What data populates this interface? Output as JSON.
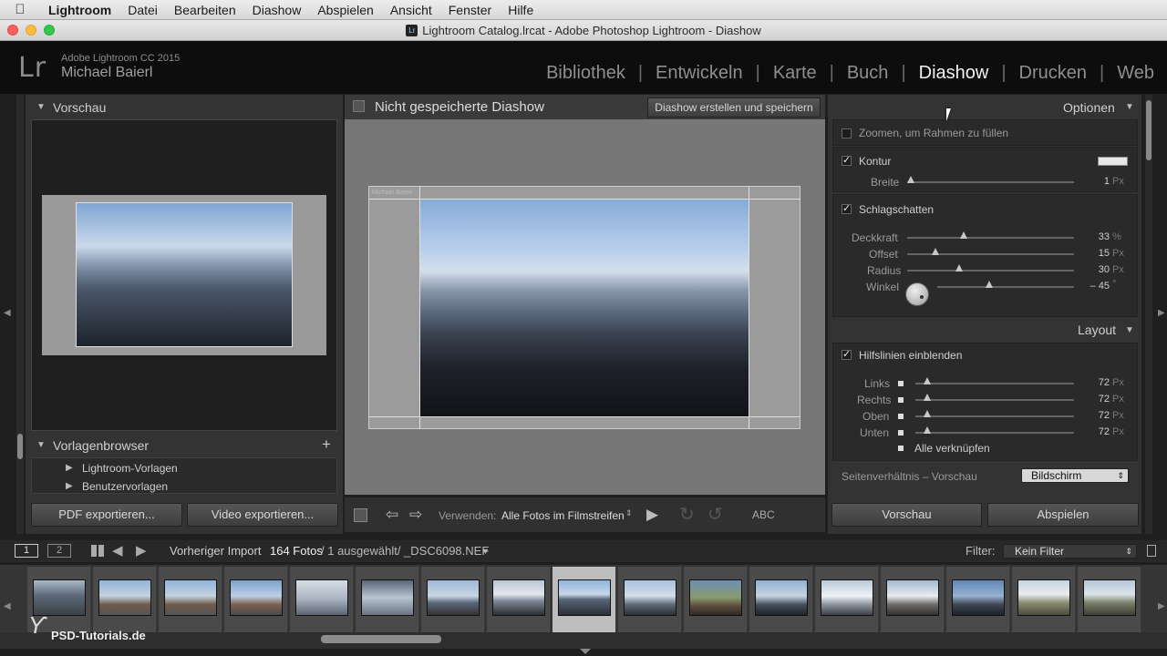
{
  "menubar": {
    "app": "Lightroom",
    "items": [
      "Datei",
      "Bearbeiten",
      "Diashow",
      "Abspielen",
      "Ansicht",
      "Fenster",
      "Hilfe"
    ]
  },
  "window": {
    "title": "Lightroom Catalog.lrcat - Adobe Photoshop Lightroom - Diashow"
  },
  "identity": {
    "logo": "Lr",
    "product": "Adobe Lightroom CC 2015",
    "user": "Michael Baierl"
  },
  "modules": [
    "Bibliothek",
    "Entwickeln",
    "Karte",
    "Buch",
    "Diashow",
    "Drucken",
    "Web"
  ],
  "left": {
    "preview_header": "Vorschau",
    "template_header": "Vorlagenbrowser",
    "templates": [
      "Lightroom-Vorlagen",
      "Benutzervorlagen"
    ],
    "pdf_button": "PDF exportieren...",
    "video_button": "Video exportieren..."
  },
  "center": {
    "title": "Nicht gespeicherte Diashow",
    "create_button": "Diashow erstellen und speichern",
    "identity_plate_text": "Michael Baierl",
    "use_label": "Verwenden:",
    "use_value": "Alle Fotos im Filmstreifen",
    "abc": "ABC"
  },
  "options": {
    "header": "Optionen",
    "zoom_label": "Zoomen, um Rahmen zu füllen",
    "kontur_label": "Kontur",
    "breite_label": "Breite",
    "breite_value": "1",
    "breite_unit": "Px",
    "shadow_label": "Schlagschatten",
    "deckkraft_label": "Deckkraft",
    "deckkraft_value": "33",
    "deckkraft_unit": "%",
    "offset_label": "Offset",
    "offset_value": "15",
    "offset_unit": "Px",
    "radius_label": "Radius",
    "radius_value": "30",
    "radius_unit": "Px",
    "winkel_label": "Winkel",
    "winkel_value": "– 45",
    "winkel_unit": "°"
  },
  "layout": {
    "header": "Layout",
    "guides_label": "Hilfslinien einblenden",
    "links_label": "Links",
    "links_value": "72",
    "rechts_label": "Rechts",
    "rechts_value": "72",
    "oben_label": "Oben",
    "oben_value": "72",
    "unten_label": "Unten",
    "unten_value": "72",
    "unit": "Px",
    "link_all_label": "Alle verknüpfen",
    "aspect_label": "Seitenverhältnis – Vorschau",
    "aspect_value": "Bildschirm"
  },
  "right_buttons": {
    "preview": "Vorschau",
    "play": "Abspielen"
  },
  "filmbar": {
    "screen1": "1",
    "screen2": "2",
    "source": "Vorheriger Import",
    "count": "164 Fotos",
    "selection": "/ 1 ausgewählt/ _DSC6098.NEF",
    "filter_label": "Filter:",
    "filter_value": "Kein Filter"
  },
  "watermark": "PSD-Tutorials.de"
}
